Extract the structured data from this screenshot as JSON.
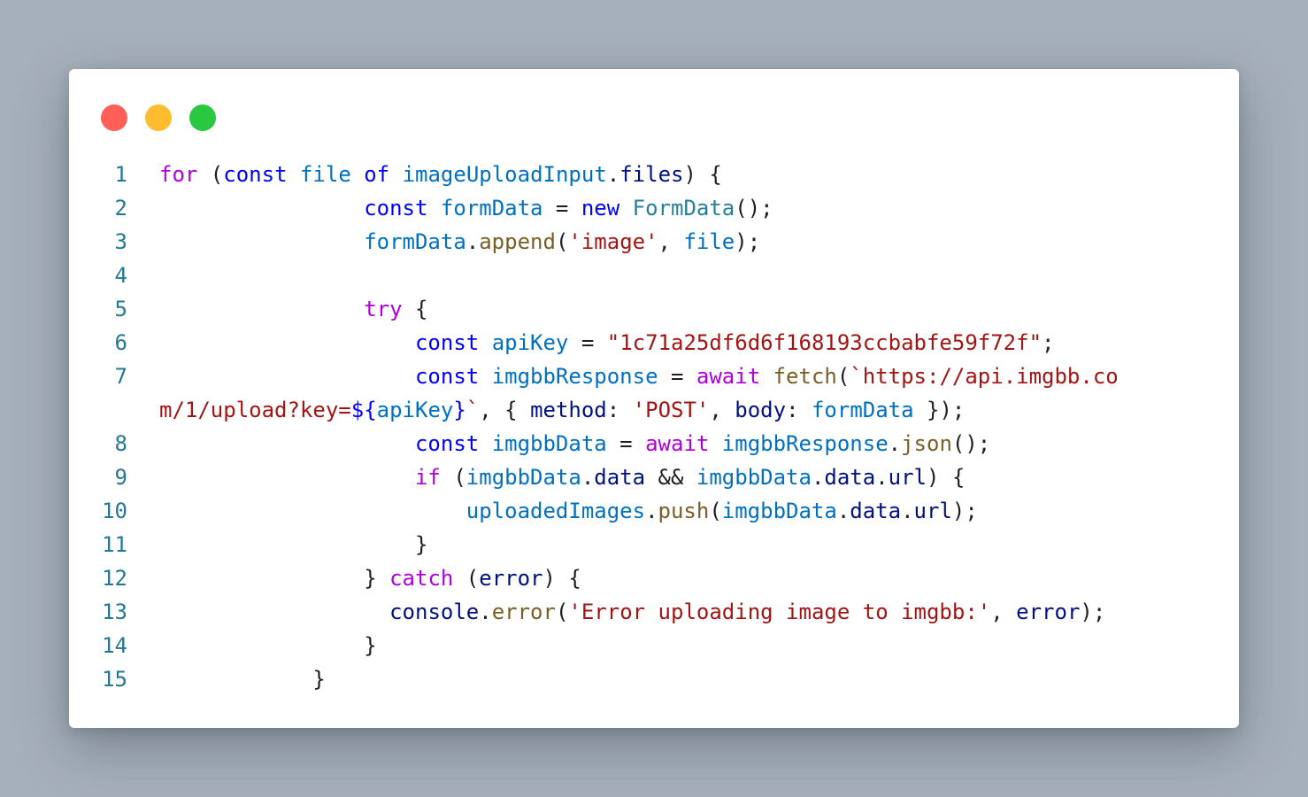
{
  "window": {
    "controls": [
      {
        "name": "close",
        "color": "#ff5f57"
      },
      {
        "name": "minimize",
        "color": "#febc2e"
      },
      {
        "name": "maximize",
        "color": "#28c840"
      }
    ]
  },
  "colors": {
    "background": "#a6b0bb",
    "line_number": "#237893",
    "keyword_control": "#af00db",
    "keyword": "#0000ff",
    "variable": "#0070c1",
    "property": "#001080",
    "function": "#795e26",
    "class": "#267f99",
    "string": "#a31515"
  },
  "code": {
    "lines": [
      {
        "n": "1",
        "tokens": [
          {
            "t": "for",
            "c": "kw-c"
          },
          {
            "t": " (",
            "c": "pun"
          },
          {
            "t": "const",
            "c": "kw"
          },
          {
            "t": " ",
            "c": "pun"
          },
          {
            "t": "file",
            "c": "var"
          },
          {
            "t": " ",
            "c": "pun"
          },
          {
            "t": "of",
            "c": "kw"
          },
          {
            "t": " ",
            "c": "pun"
          },
          {
            "t": "imageUploadInput",
            "c": "var"
          },
          {
            "t": ".",
            "c": "pun"
          },
          {
            "t": "files",
            "c": "prop"
          },
          {
            "t": ") {",
            "c": "pun"
          }
        ]
      },
      {
        "n": "2",
        "tokens": [
          {
            "t": "                ",
            "c": "pun"
          },
          {
            "t": "const",
            "c": "kw"
          },
          {
            "t": " ",
            "c": "pun"
          },
          {
            "t": "formData",
            "c": "var"
          },
          {
            "t": " = ",
            "c": "pun"
          },
          {
            "t": "new",
            "c": "kw"
          },
          {
            "t": " ",
            "c": "pun"
          },
          {
            "t": "FormData",
            "c": "cls"
          },
          {
            "t": "();",
            "c": "pun"
          }
        ]
      },
      {
        "n": "3",
        "tokens": [
          {
            "t": "                ",
            "c": "pun"
          },
          {
            "t": "formData",
            "c": "var"
          },
          {
            "t": ".",
            "c": "pun"
          },
          {
            "t": "append",
            "c": "fn"
          },
          {
            "t": "(",
            "c": "pun"
          },
          {
            "t": "'image'",
            "c": "str"
          },
          {
            "t": ", ",
            "c": "pun"
          },
          {
            "t": "file",
            "c": "var"
          },
          {
            "t": ");",
            "c": "pun"
          }
        ]
      },
      {
        "n": "4",
        "tokens": []
      },
      {
        "n": "5",
        "tokens": [
          {
            "t": "                ",
            "c": "pun"
          },
          {
            "t": "try",
            "c": "kw-c"
          },
          {
            "t": " {",
            "c": "pun"
          }
        ]
      },
      {
        "n": "6",
        "tokens": [
          {
            "t": "                    ",
            "c": "pun"
          },
          {
            "t": "const",
            "c": "kw"
          },
          {
            "t": " ",
            "c": "pun"
          },
          {
            "t": "apiKey",
            "c": "var"
          },
          {
            "t": " = ",
            "c": "pun"
          },
          {
            "t": "\"1c71a25df6d6f168193ccbabfe59f72f\"",
            "c": "str"
          },
          {
            "t": ";",
            "c": "pun"
          }
        ]
      },
      {
        "n": "7",
        "tokens": [
          {
            "t": "                    ",
            "c": "pun"
          },
          {
            "t": "const",
            "c": "kw"
          },
          {
            "t": " ",
            "c": "pun"
          },
          {
            "t": "imgbbResponse",
            "c": "var"
          },
          {
            "t": " = ",
            "c": "pun"
          },
          {
            "t": "await",
            "c": "kw-c"
          },
          {
            "t": " ",
            "c": "pun"
          },
          {
            "t": "fetch",
            "c": "fn"
          },
          {
            "t": "(",
            "c": "pun"
          },
          {
            "t": "`https://api.imgbb.co",
            "c": "str"
          }
        ]
      },
      {
        "n": "",
        "tokens": [
          {
            "t": "m/1/upload?key=",
            "c": "str"
          },
          {
            "t": "${",
            "c": "kw"
          },
          {
            "t": "apiKey",
            "c": "var"
          },
          {
            "t": "}",
            "c": "kw"
          },
          {
            "t": "`",
            "c": "str"
          },
          {
            "t": ", { ",
            "c": "pun"
          },
          {
            "t": "method",
            "c": "prop"
          },
          {
            "t": ": ",
            "c": "pun"
          },
          {
            "t": "'POST'",
            "c": "str"
          },
          {
            "t": ", ",
            "c": "pun"
          },
          {
            "t": "body",
            "c": "prop"
          },
          {
            "t": ": ",
            "c": "pun"
          },
          {
            "t": "formData",
            "c": "var"
          },
          {
            "t": " });",
            "c": "pun"
          }
        ]
      },
      {
        "n": "8",
        "tokens": [
          {
            "t": "                    ",
            "c": "pun"
          },
          {
            "t": "const",
            "c": "kw"
          },
          {
            "t": " ",
            "c": "pun"
          },
          {
            "t": "imgbbData",
            "c": "var"
          },
          {
            "t": " = ",
            "c": "pun"
          },
          {
            "t": "await",
            "c": "kw-c"
          },
          {
            "t": " ",
            "c": "pun"
          },
          {
            "t": "imgbbResponse",
            "c": "var"
          },
          {
            "t": ".",
            "c": "pun"
          },
          {
            "t": "json",
            "c": "fn"
          },
          {
            "t": "();",
            "c": "pun"
          }
        ]
      },
      {
        "n": "9",
        "tokens": [
          {
            "t": "                    ",
            "c": "pun"
          },
          {
            "t": "if",
            "c": "kw-c"
          },
          {
            "t": " (",
            "c": "pun"
          },
          {
            "t": "imgbbData",
            "c": "var"
          },
          {
            "t": ".",
            "c": "pun"
          },
          {
            "t": "data",
            "c": "prop"
          },
          {
            "t": " && ",
            "c": "pun"
          },
          {
            "t": "imgbbData",
            "c": "var"
          },
          {
            "t": ".",
            "c": "pun"
          },
          {
            "t": "data",
            "c": "prop"
          },
          {
            "t": ".",
            "c": "pun"
          },
          {
            "t": "url",
            "c": "prop"
          },
          {
            "t": ") {",
            "c": "pun"
          }
        ]
      },
      {
        "n": "10",
        "tokens": [
          {
            "t": "                        ",
            "c": "pun"
          },
          {
            "t": "uploadedImages",
            "c": "var"
          },
          {
            "t": ".",
            "c": "pun"
          },
          {
            "t": "push",
            "c": "fn"
          },
          {
            "t": "(",
            "c": "pun"
          },
          {
            "t": "imgbbData",
            "c": "var"
          },
          {
            "t": ".",
            "c": "pun"
          },
          {
            "t": "data",
            "c": "prop"
          },
          {
            "t": ".",
            "c": "pun"
          },
          {
            "t": "url",
            "c": "prop"
          },
          {
            "t": ");",
            "c": "pun"
          }
        ]
      },
      {
        "n": "11",
        "tokens": [
          {
            "t": "                    }",
            "c": "pun"
          }
        ]
      },
      {
        "n": "12",
        "tokens": [
          {
            "t": "                } ",
            "c": "pun"
          },
          {
            "t": "catch",
            "c": "kw-c"
          },
          {
            "t": " (",
            "c": "pun"
          },
          {
            "t": "error",
            "c": "prop"
          },
          {
            "t": ") {",
            "c": "pun"
          }
        ]
      },
      {
        "n": "13",
        "tokens": [
          {
            "t": "                  ",
            "c": "pun"
          },
          {
            "t": "console",
            "c": "prop"
          },
          {
            "t": ".",
            "c": "pun"
          },
          {
            "t": "error",
            "c": "fn"
          },
          {
            "t": "(",
            "c": "pun"
          },
          {
            "t": "'Error uploading image to imgbb:'",
            "c": "str"
          },
          {
            "t": ", ",
            "c": "pun"
          },
          {
            "t": "error",
            "c": "prop"
          },
          {
            "t": ");",
            "c": "pun"
          }
        ]
      },
      {
        "n": "14",
        "tokens": [
          {
            "t": "                }",
            "c": "pun"
          }
        ]
      },
      {
        "n": "15",
        "tokens": [
          {
            "t": "            }",
            "c": "pun"
          }
        ]
      }
    ]
  }
}
